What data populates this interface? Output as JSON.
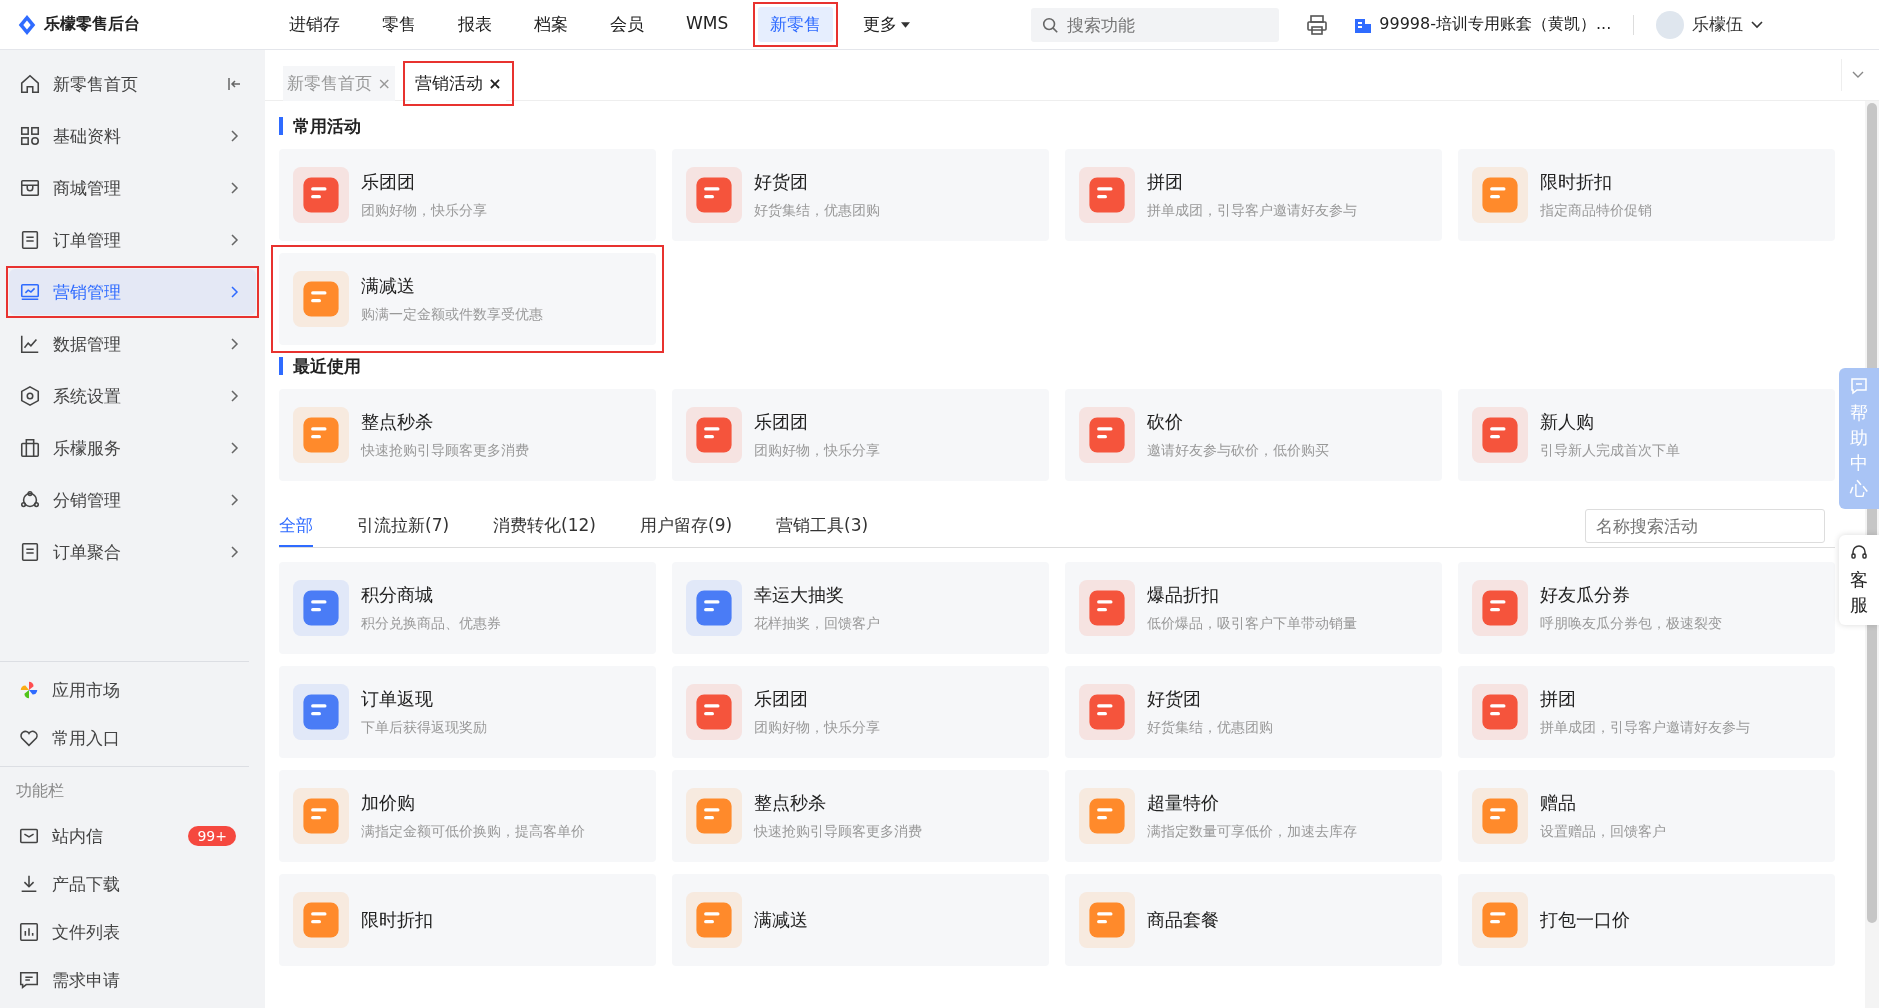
{
  "app": {
    "title": "乐檬零售后台"
  },
  "nav": [
    {
      "label": "进销存",
      "selected": false,
      "highlighted": false,
      "kind": "link"
    },
    {
      "label": "零售",
      "selected": false,
      "highlighted": false,
      "kind": "link"
    },
    {
      "label": "报表",
      "selected": false,
      "highlighted": false,
      "kind": "link"
    },
    {
      "label": "档案",
      "selected": false,
      "highlighted": false,
      "kind": "link"
    },
    {
      "label": "会员",
      "selected": false,
      "highlighted": false,
      "kind": "link"
    },
    {
      "label": "WMS",
      "selected": false,
      "highlighted": false,
      "kind": "link"
    },
    {
      "label": "新零售",
      "selected": true,
      "highlighted": true,
      "kind": "link"
    },
    {
      "label": "更多",
      "selected": false,
      "highlighted": false,
      "kind": "dropdown"
    }
  ],
  "search": {
    "placeholder": "搜索功能"
  },
  "account": {
    "label": "99998-培训专用账套（黄凯）..."
  },
  "user": {
    "name": "乐檬伍"
  },
  "sidebar": {
    "items": [
      {
        "label": "新零售首页",
        "selected": false,
        "highlighted": false,
        "kind": "home"
      },
      {
        "label": "基础资料",
        "selected": false,
        "highlighted": false,
        "kind": "group"
      },
      {
        "label": "商城管理",
        "selected": false,
        "highlighted": false,
        "kind": "group"
      },
      {
        "label": "订单管理",
        "selected": false,
        "highlighted": false,
        "kind": "group"
      },
      {
        "label": "营销管理",
        "selected": true,
        "highlighted": true,
        "kind": "group"
      },
      {
        "label": "数据管理",
        "selected": false,
        "highlighted": false,
        "kind": "group"
      },
      {
        "label": "系统设置",
        "selected": false,
        "highlighted": false,
        "kind": "group"
      },
      {
        "label": "乐檬服务",
        "selected": false,
        "highlighted": false,
        "kind": "group"
      },
      {
        "label": "分销管理",
        "selected": false,
        "highlighted": false,
        "kind": "group"
      },
      {
        "label": "订单聚合",
        "selected": false,
        "highlighted": false,
        "kind": "group"
      }
    ],
    "shortcuts": [
      {
        "label": "应用市场"
      },
      {
        "label": "常用入口"
      }
    ],
    "section_label": "功能栏",
    "tools": [
      {
        "label": "站内信",
        "badge": "99+"
      },
      {
        "label": "产品下载"
      },
      {
        "label": "文件列表"
      },
      {
        "label": "需求申请"
      }
    ]
  },
  "tabs": [
    {
      "label": "新零售首页",
      "selected": false,
      "highlighted": false,
      "close": "×"
    },
    {
      "label": "营销活动",
      "selected": true,
      "highlighted": true,
      "close": "×"
    }
  ],
  "sections": [
    {
      "title": "常用活动",
      "items": [
        {
          "title": "乐团团",
          "desc": "团购好物，快乐分享",
          "color": "#f5543c",
          "highlighted": false
        },
        {
          "title": "好货团",
          "desc": "好货集结，优惠团购",
          "color": "#f5543c",
          "highlighted": false
        },
        {
          "title": "拼团",
          "desc": "拼单成团，引导客户邀请好友参与",
          "color": "#f5543c",
          "highlighted": false
        },
        {
          "title": "限时折扣",
          "desc": "指定商品特价促销",
          "color": "#ff8a2b",
          "highlighted": false
        },
        {
          "title": "满减送",
          "desc": "购满一定金额或件数享受优惠",
          "color": "#ff8a2b",
          "highlighted": true
        }
      ]
    },
    {
      "title": "最近使用",
      "items": [
        {
          "title": "整点秒杀",
          "desc": "快速抢购引导顾客更多消费",
          "color": "#ff8a2b",
          "highlighted": false
        },
        {
          "title": "乐团团",
          "desc": "团购好物，快乐分享",
          "color": "#f5543c",
          "highlighted": false
        },
        {
          "title": "砍价",
          "desc": "邀请好友参与砍价，低价购买",
          "color": "#f5543c",
          "highlighted": false
        },
        {
          "title": "新人购",
          "desc": "引导新人完成首次下单",
          "color": "#f5543c",
          "highlighted": false
        }
      ]
    }
  ],
  "filter_tabs": [
    {
      "label": "全部",
      "selected": true
    },
    {
      "label": "引流拉新(7)",
      "selected": false
    },
    {
      "label": "消费转化(12)",
      "selected": false
    },
    {
      "label": "用户留存(9)",
      "selected": false
    },
    {
      "label": "营销工具(3)",
      "selected": false
    }
  ],
  "activity_search": {
    "placeholder": "名称搜索活动"
  },
  "activities": [
    {
      "title": "积分商城",
      "desc": "积分兑换商品、优惠券",
      "color": "#4a7cf6"
    },
    {
      "title": "幸运大抽奖",
      "desc": "花样抽奖，回馈客户",
      "color": "#4a7cf6"
    },
    {
      "title": "爆品折扣",
      "desc": "低价爆品，吸引客户下单带动销量",
      "color": "#f5543c"
    },
    {
      "title": "好友瓜分券",
      "desc": "呼朋唤友瓜分券包，极速裂变",
      "color": "#f5543c"
    },
    {
      "title": "订单返现",
      "desc": "下单后获得返现奖励",
      "color": "#4a7cf6"
    },
    {
      "title": "乐团团",
      "desc": "团购好物，快乐分享",
      "color": "#f5543c"
    },
    {
      "title": "好货团",
      "desc": "好货集结，优惠团购",
      "color": "#f5543c"
    },
    {
      "title": "拼团",
      "desc": "拼单成团，引导客户邀请好友参与",
      "color": "#f5543c"
    },
    {
      "title": "加价购",
      "desc": "满指定金额可低价换购，提高客单价",
      "color": "#ff8a2b"
    },
    {
      "title": "整点秒杀",
      "desc": "快速抢购引导顾客更多消费",
      "color": "#ff8a2b"
    },
    {
      "title": "超量特价",
      "desc": "满指定数量可享低价，加速去库存",
      "color": "#ff8a2b"
    },
    {
      "title": "赠品",
      "desc": "设置赠品，回馈客户",
      "color": "#ff8a2b"
    },
    {
      "title": "限时折扣",
      "color": "#ff8a2b"
    },
    {
      "title": "满减送",
      "color": "#ff8a2b"
    },
    {
      "title": "商品套餐",
      "color": "#ff8a2b"
    },
    {
      "title": "打包一口价",
      "color": "#ff8a2b"
    }
  ],
  "float_buttons": [
    {
      "label": "帮助中心",
      "kind": "help"
    },
    {
      "label": "客服",
      "kind": "service"
    }
  ]
}
